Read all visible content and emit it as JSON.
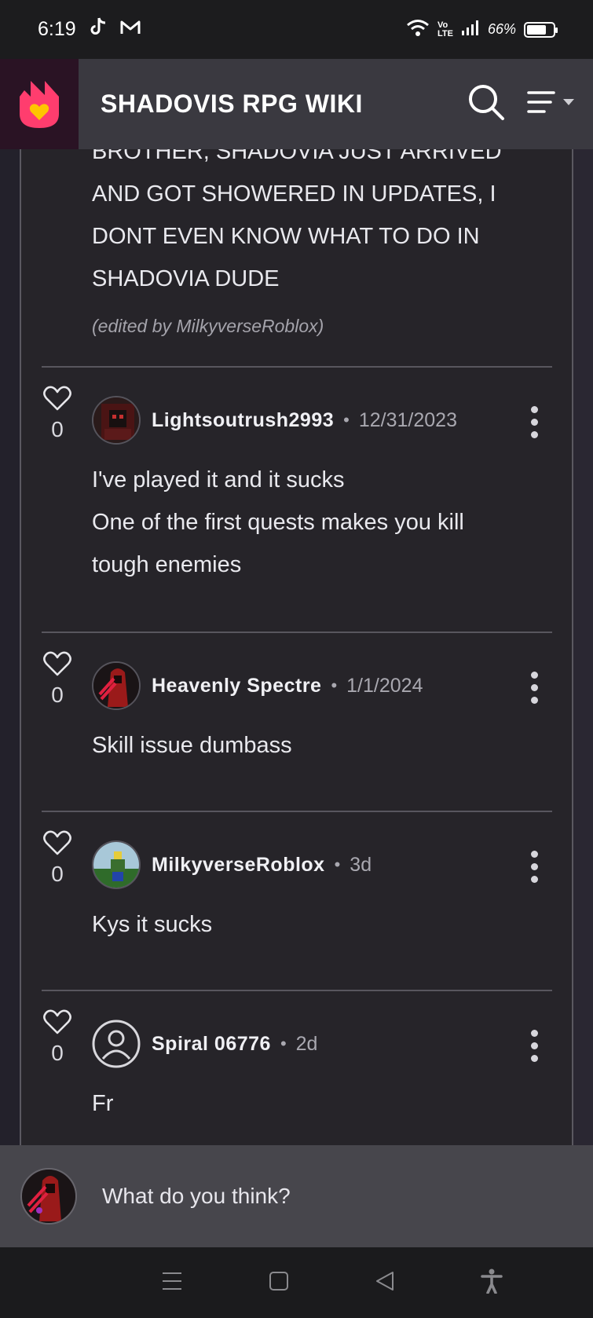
{
  "status_bar": {
    "time": "6:19",
    "battery_percent": "66%",
    "icons": [
      "tiktok-icon",
      "gmail-icon",
      "wifi-icon",
      "volte-icon",
      "signal-icon",
      "battery-icon"
    ],
    "volte_label_top": "Vo",
    "volte_label_bottom": "LTE"
  },
  "header": {
    "title": "SHADOVIS RPG WIKI",
    "logo": "fandom-flame-logo",
    "icons": [
      "search-icon",
      "menu-icon"
    ],
    "accent_color": "#ff3d6e"
  },
  "previous_comment": {
    "body_lines": [
      "BROTHER, SHADOVIA JUST ARRIVED",
      "AND GOT SHOWERED IN UPDATES, I",
      "DONT EVEN KNOW WHAT TO DO IN",
      "SHADOVIA DUDE"
    ],
    "edited_note": "(edited by MilkyverseRoblox)"
  },
  "comments": [
    {
      "like_count": "0",
      "username": "Lightsoutrush2993",
      "separator": "•",
      "date": "12/31/2023",
      "body_lines": [
        "I've played it and it sucks",
        "One of the first quests makes you kill",
        "tough enemies"
      ]
    },
    {
      "like_count": "0",
      "username": "Heavenly Spectre",
      "separator": "•",
      "date": "1/1/2024",
      "body_lines": [
        "Skill issue dumbass"
      ]
    },
    {
      "like_count": "0",
      "username": "MilkyverseRoblox",
      "separator": "•",
      "date": "3d",
      "body_lines": [
        "Kys it sucks"
      ]
    },
    {
      "like_count": "0",
      "username": "Spiral 06776",
      "separator": "•",
      "date": "2d",
      "body_lines": [
        "Fr"
      ]
    }
  ],
  "reply": {
    "placeholder": "What do you think?"
  },
  "nav_bar": {
    "icons": [
      "recents-icon",
      "home-icon",
      "back-icon",
      "accessibility-icon"
    ]
  }
}
